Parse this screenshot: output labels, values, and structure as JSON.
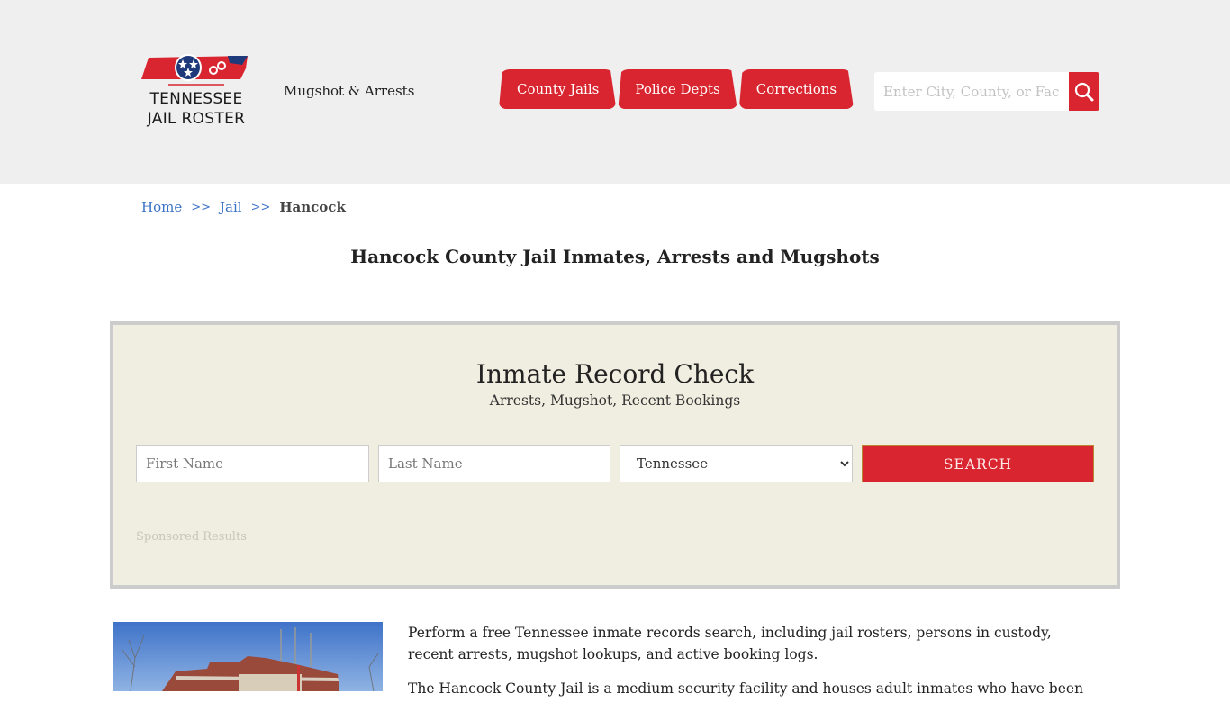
{
  "header": {
    "logo": {
      "line1": "TENNESSEE",
      "line2": "JAIL ROSTER",
      "icon": "tennessee-state-flag-handcuffs-icon"
    },
    "tagline": "Mugshot & Arrests",
    "nav": [
      {
        "label": "County Jails"
      },
      {
        "label": "Police Depts"
      },
      {
        "label": "Corrections"
      }
    ],
    "search": {
      "placeholder": "Enter City, County, or Facility",
      "value": "",
      "icon": "search-icon"
    }
  },
  "breadcrumb": {
    "items": [
      {
        "label": "Home"
      },
      {
        "label": "Jail"
      }
    ],
    "separator": ">>",
    "current": "Hancock"
  },
  "page_title": "Hancock County Jail Inmates, Arrests and Mugshots",
  "record_check": {
    "title": "Inmate Record Check",
    "subtitle": "Arrests, Mugshot, Recent Bookings",
    "first_name_placeholder": "First Name",
    "last_name_placeholder": "Last Name",
    "state_selected": "Tennessee",
    "search_label": "SEARCH",
    "sponsored_label": "Sponsored Results"
  },
  "content": {
    "paragraphs": [
      "Perform a free Tennessee inmate records search, including jail rosters, persons in custody, recent arrests, mugshot lookups, and active booking logs.",
      "The Hancock County Jail is a medium security facility and houses adult inmates who have been"
    ],
    "image_alt": "Hancock County courthouse building"
  },
  "colors": {
    "accent_red": "#d9252f",
    "link_blue": "#3b72c6",
    "header_bg": "#efefef",
    "panel_bg": "#f0eee0",
    "panel_border": "#cccccc"
  }
}
